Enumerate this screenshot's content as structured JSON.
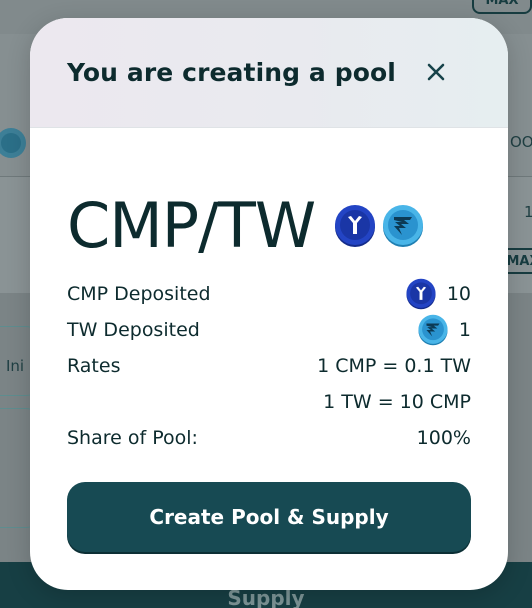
{
  "background": {
    "max_top": "MAX",
    "max_mid": "MAX",
    "label_fragment": "Ini",
    "side_fragment": "OO",
    "side_number": "1",
    "supply_label": "Supply"
  },
  "modal": {
    "title": "You are creating a pool",
    "pair": "CMP/TW",
    "cmp_icon": "cmp-token-icon",
    "tw_icon": "tw-token-icon",
    "rows": [
      {
        "label": "CMP Deposited",
        "value": "10",
        "icon": "cmp-token-icon"
      },
      {
        "label": "TW Deposited",
        "value": "1",
        "icon": "tw-token-icon"
      },
      {
        "label": "Rates",
        "value": "1 CMP = 0.1 TW"
      },
      {
        "label": "",
        "value": "1 TW = 10 CMP"
      },
      {
        "label": "Share of Pool:",
        "value": "100%"
      }
    ],
    "button_label": "Create Pool & Supply"
  },
  "colors": {
    "primary": "#174a53",
    "cmp_blue": "#1f3fb8",
    "tw_cyan": "#3aa8e0"
  }
}
